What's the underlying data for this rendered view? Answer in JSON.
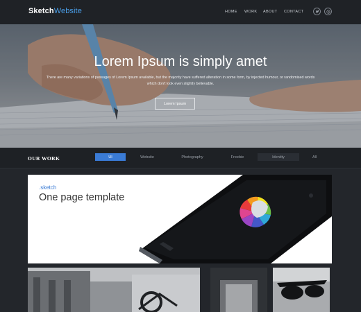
{
  "header": {
    "logo_main": "Sketch",
    "logo_accent": "Website",
    "nav": [
      "HOME",
      "WORK",
      "ABOUT",
      "CONTACT"
    ],
    "social_icons": [
      "twitter-icon",
      "dribbble-icon"
    ]
  },
  "hero": {
    "title": "Lorem Ipsum is simply amet",
    "text": "There are many variations of passages of Lorem Ipsum available, but the majority have suffered alteration in some form, by injected humour, or randomised words which don't look even slightly believable.",
    "button": "Lorem Ipsum"
  },
  "work": {
    "title": "OUR WORK",
    "filters": [
      "UI",
      "Website",
      "Photography",
      "Freebie",
      "Identity",
      "All"
    ],
    "active_filter": "UI"
  },
  "feature": {
    "brand": ".sketch",
    "title": "One page template"
  },
  "colors": {
    "accent": "#3a7bd5",
    "background": "#23262b",
    "header": "#1f2226"
  }
}
